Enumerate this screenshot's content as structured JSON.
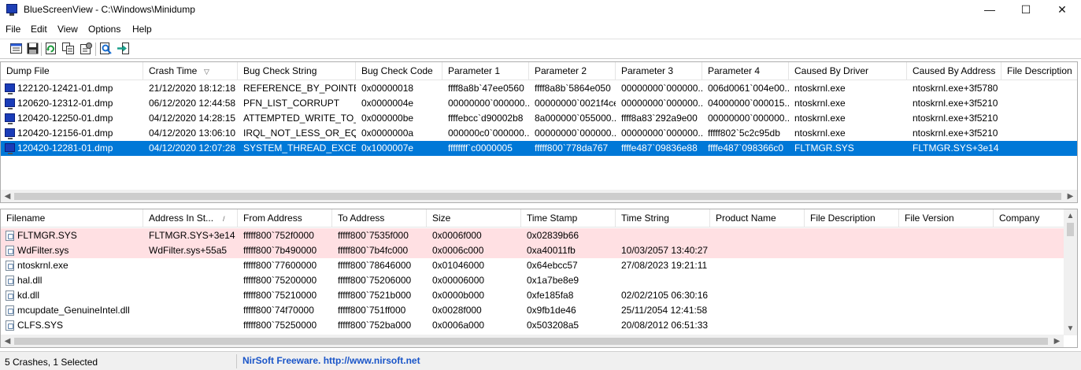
{
  "window": {
    "title": "BlueScreenView  -  C:\\Windows\\Minidump",
    "minimize": "—",
    "maximize": "☐",
    "close": "✕"
  },
  "menu": [
    "File",
    "Edit",
    "View",
    "Options",
    "Help"
  ],
  "toolbar_icons": [
    "properties-icon",
    "save-icon",
    "refresh-icon",
    "copy-icon",
    "advanced-options-icon",
    "find-icon",
    "exit-icon"
  ],
  "crash_table": {
    "columns": [
      "Dump File",
      "Crash Time",
      "Bug Check String",
      "Bug Check Code",
      "Parameter 1",
      "Parameter 2",
      "Parameter 3",
      "Parameter 4",
      "Caused By Driver",
      "Caused By Address",
      "File Description"
    ],
    "sort_indicator": "▽",
    "rows": [
      [
        "122120-12421-01.dmp",
        "21/12/2020 18:12:18",
        "REFERENCE_BY_POINTER",
        "0x00000018",
        "ffff8a8b`47ee0560",
        "ffff8a8b`5864e050",
        "00000000`000000...",
        "006d0061`004e00...",
        "ntoskrnl.exe",
        "ntoskrnl.exe+3f5780",
        ""
      ],
      [
        "120620-12312-01.dmp",
        "06/12/2020 12:44:58",
        "PFN_LIST_CORRUPT",
        "0x0000004e",
        "00000000`000000...",
        "00000000`0021f4ce",
        "00000000`000000...",
        "04000000`000015...",
        "ntoskrnl.exe",
        "ntoskrnl.exe+3f5210",
        ""
      ],
      [
        "120420-12250-01.dmp",
        "04/12/2020 14:28:15",
        "ATTEMPTED_WRITE_TO_...",
        "0x000000be",
        "ffffebcc`d90002b8",
        "8a000000`055000...",
        "ffff8a83`292a9e00",
        "00000000`000000...",
        "ntoskrnl.exe",
        "ntoskrnl.exe+3f5210",
        ""
      ],
      [
        "120420-12156-01.dmp",
        "04/12/2020 13:06:10",
        "IRQL_NOT_LESS_OR_EQ...",
        "0x0000000a",
        "000000c0`000000...",
        "00000000`000000...",
        "00000000`000000...",
        "fffff802`5c2c95db",
        "ntoskrnl.exe",
        "ntoskrnl.exe+3f5210",
        ""
      ],
      [
        "120420-12281-01.dmp",
        "04/12/2020 12:07:28",
        "SYSTEM_THREAD_EXCE...",
        "0x1000007e",
        "ffffffff`c0000005",
        "fffff800`778da767",
        "ffffe487`09836e88",
        "ffffe487`098366c0",
        "FLTMGR.SYS",
        "FLTMGR.SYS+3e14",
        ""
      ]
    ],
    "selected_row": 4
  },
  "driver_table": {
    "columns": [
      "Filename",
      "Address In St...",
      "From Address",
      "To Address",
      "Size",
      "Time Stamp",
      "Time String",
      "Product Name",
      "File Description",
      "File Version",
      "Company"
    ],
    "sort_indicator": "/",
    "rows": [
      [
        "FLTMGR.SYS",
        "FLTMGR.SYS+3e14",
        "fffff800`752f0000",
        "fffff800`7535f000",
        "0x0006f000",
        "0x02839b66",
        "",
        "",
        "",
        "",
        ""
      ],
      [
        "WdFilter.sys",
        "WdFilter.sys+55a5",
        "fffff800`7b490000",
        "fffff800`7b4fc000",
        "0x0006c000",
        "0xa40011fb",
        "10/03/2057 13:40:27",
        "",
        "",
        "",
        ""
      ],
      [
        "ntoskrnl.exe",
        "",
        "fffff800`77600000",
        "fffff800`78646000",
        "0x01046000",
        "0x64ebcc57",
        "27/08/2023 19:21:11",
        "",
        "",
        "",
        ""
      ],
      [
        "hal.dll",
        "",
        "fffff800`75200000",
        "fffff800`75206000",
        "0x00006000",
        "0x1a7be8e9",
        "",
        "",
        "",
        "",
        ""
      ],
      [
        "kd.dll",
        "",
        "fffff800`75210000",
        "fffff800`7521b000",
        "0x0000b000",
        "0xfe185fa8",
        "02/02/2105 06:30:16",
        "",
        "",
        "",
        ""
      ],
      [
        "mcupdate_GenuineIntel.dll",
        "",
        "fffff800`74f70000",
        "fffff800`751ff000",
        "0x0028f000",
        "0x9fb1de46",
        "25/11/2054 12:41:58",
        "",
        "",
        "",
        ""
      ],
      [
        "CLFS.SYS",
        "",
        "fffff800`75250000",
        "fffff800`752ba000",
        "0x0006a000",
        "0x503208a5",
        "20/08/2012 06:51:33",
        "",
        "",
        "",
        ""
      ]
    ],
    "highlighted_rows": [
      0,
      1
    ]
  },
  "status": {
    "summary": "5 Crashes, 1 Selected",
    "credit": "NirSoft Freeware.  http://www.nirsoft.net"
  },
  "colors": {
    "selection": "#0078d7",
    "highlight": "#ffe0e3",
    "credit_link": "#1a55c8"
  }
}
